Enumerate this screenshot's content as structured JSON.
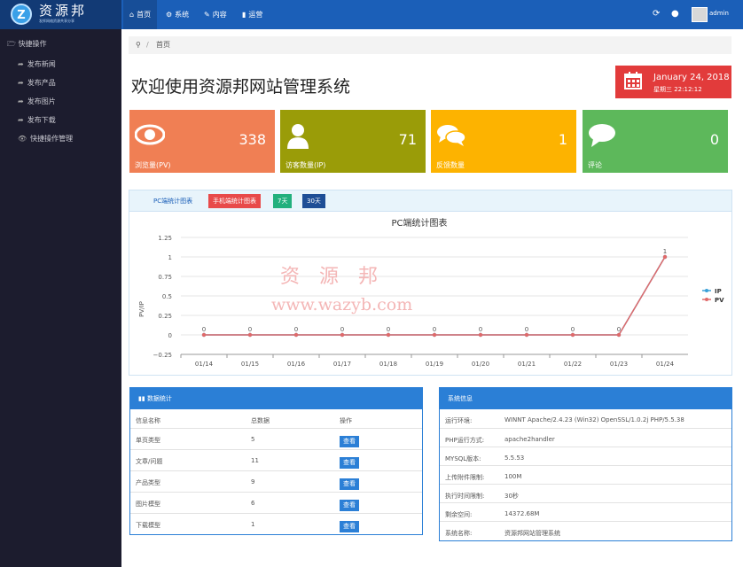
{
  "logo": {
    "mark": "Z",
    "name": "资源邦",
    "slogan": "发挥网络资源共享分享"
  },
  "nav": [
    {
      "label": "首页",
      "icon": "home-icon",
      "glyph": "⌂"
    },
    {
      "label": "系统",
      "icon": "cogs-icon",
      "glyph": "⚙"
    },
    {
      "label": "内容",
      "icon": "edit-icon",
      "glyph": "✎"
    },
    {
      "label": "运营",
      "icon": "bar-chart-icon",
      "glyph": "▮"
    }
  ],
  "user": {
    "name": "admin"
  },
  "sidebar": {
    "heading": "快捷操作",
    "items": [
      {
        "label": "发布新闻",
        "glyph": "➦"
      },
      {
        "label": "发布产品",
        "glyph": "➦"
      },
      {
        "label": "发布图片",
        "glyph": "➦"
      },
      {
        "label": "发布下载",
        "glyph": "➦"
      },
      {
        "label": "快捷操作管理",
        "glyph": "👁"
      }
    ]
  },
  "breadcrumb": {
    "sep": "/",
    "current": "首页"
  },
  "page": {
    "title": "欢迎使用资源邦网站管理系统",
    "date": "January 24, 2018",
    "weekday_time": "星期三  22:12:12"
  },
  "cards": [
    {
      "label": "浏览量(PV)",
      "value": "338",
      "color": "#f07f54",
      "icon": "eye-icon"
    },
    {
      "label": "访客数量(IP)",
      "value": "71",
      "color": "#9a9c08",
      "icon": "user-icon"
    },
    {
      "label": "反馈数量",
      "value": "1",
      "color": "#fdb300",
      "icon": "comments-icon"
    },
    {
      "label": "评论",
      "value": "0",
      "color": "#5db85b",
      "icon": "comment-icon"
    }
  ],
  "chart_header": {
    "tab": "PC端统计图表",
    "btn_mobile": "手机端统计图表",
    "btn_7": "7天",
    "btn_30": "30天"
  },
  "chart_data": {
    "type": "line",
    "title": "PC端统计图表",
    "ylabel": "PV/IP",
    "categories": [
      "01/14",
      "01/15",
      "01/16",
      "01/17",
      "01/18",
      "01/19",
      "01/20",
      "01/21",
      "01/22",
      "01/23",
      "01/24"
    ],
    "yticks": [
      "1.25",
      "1",
      "0.75",
      "0.5",
      "0.25",
      "0",
      "−0.25"
    ],
    "ylim": [
      -0.25,
      1.25
    ],
    "series": [
      {
        "name": "IP",
        "color": "#3aa0d8",
        "values": [
          0,
          0,
          0,
          0,
          0,
          0,
          0,
          0,
          0,
          0,
          1
        ]
      },
      {
        "name": "PV",
        "color": "#e06a6a",
        "values": [
          0,
          0,
          0,
          0,
          0,
          0,
          0,
          0,
          0,
          0,
          1
        ]
      }
    ],
    "legend": "right"
  },
  "watermark": {
    "line1": "资源邦",
    "line2": "www.wazyb.com"
  },
  "data_stats": {
    "title": "数据统计",
    "headers": [
      "信息名称",
      "总数据",
      "操作"
    ],
    "rows": [
      {
        "name": "单页类型",
        "count": "5",
        "action": "查看"
      },
      {
        "name": "文章/问题",
        "count": "11",
        "action": "查看"
      },
      {
        "name": "产品类型",
        "count": "9",
        "action": "查看"
      },
      {
        "name": "图片模型",
        "count": "6",
        "action": "查看"
      },
      {
        "name": "下载模型",
        "count": "1",
        "action": "查看"
      }
    ]
  },
  "sys_info": {
    "title": "系统信息",
    "rows": [
      {
        "k": "运行环境:",
        "v": "WINNT Apache/2.4.23 (Win32) OpenSSL/1.0.2j PHP/5.5.38"
      },
      {
        "k": "PHP运行方式:",
        "v": "apache2handler"
      },
      {
        "k": "MYSQL版本:",
        "v": "5.5.53"
      },
      {
        "k": "上传附件限制:",
        "v": "100M"
      },
      {
        "k": "执行时间限制:",
        "v": "30秒"
      },
      {
        "k": "剩余空间:",
        "v": "14372.68M"
      },
      {
        "k": "系统名称:",
        "v": "资源邦网站管理系统"
      }
    ]
  }
}
